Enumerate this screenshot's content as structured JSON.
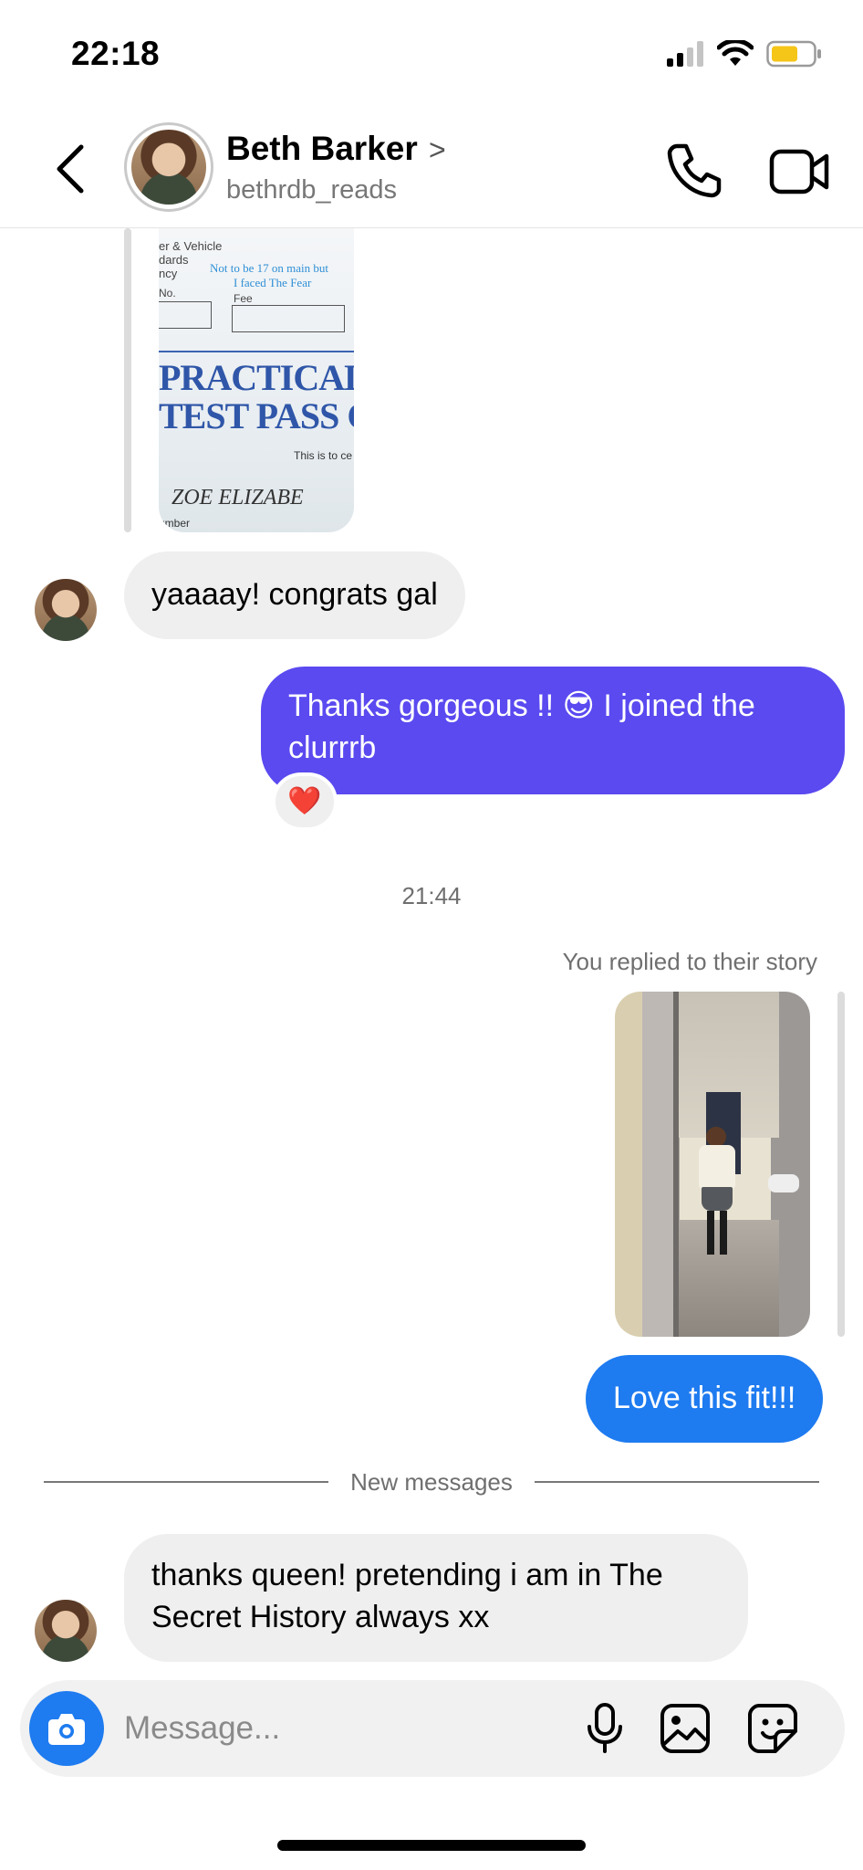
{
  "status_bar": {
    "time": "22:18",
    "battery_color": "#f5c518",
    "icons": [
      "cellular-signal-icon",
      "wifi-icon",
      "battery-icon"
    ]
  },
  "header": {
    "name": "Beth Barker",
    "username": "bethrdb_reads",
    "chevron": ">",
    "icons": [
      "back-arrow-icon",
      "phone-icon",
      "video-camera-icon"
    ]
  },
  "image1": {
    "lines": [
      "er & Vehicle",
      "dards",
      "ncy",
      "No.",
      "Fee",
      "Not to be 17 on main but",
      "I faced The Fear",
      "PRACTICAL",
      "TEST PASS C",
      "This is to ce",
      "ZOE ELIZABE",
      "umber"
    ]
  },
  "messages": [
    {
      "id": "m1",
      "side": "in",
      "text": "yaaaay! congrats gal"
    },
    {
      "id": "m2",
      "side": "out",
      "text_before": "Thanks gorgeous !! ",
      "emoji": "😎",
      "text_after": " I joined the clurrrb",
      "reaction": "❤️"
    },
    {
      "id": "m3",
      "side": "out",
      "text": "Love this fit!!!"
    },
    {
      "id": "m4",
      "side": "in",
      "text": "thanks queen! pretending i am in The Secret History always xx"
    }
  ],
  "timestamp": "21:44",
  "story_reply_note": "You replied to their story",
  "new_messages_label": "New messages",
  "composer": {
    "placeholder": "Message...",
    "value": "",
    "icons": [
      "camera-icon",
      "microphone-icon",
      "gallery-icon",
      "sticker-icon"
    ]
  },
  "colors": {
    "outgoing_purple": "#5a4af0",
    "outgoing_blue": "#1e7bf0",
    "incoming_gray": "#efefef",
    "camera_button": "#1e7bf0"
  }
}
